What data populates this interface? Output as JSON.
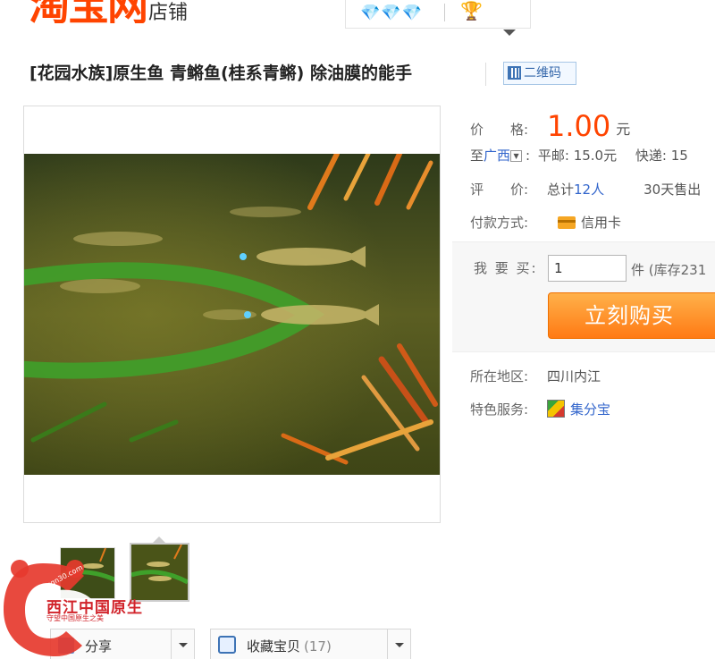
{
  "header": {
    "logo_main": "淘宝网",
    "logo_sub": "店铺",
    "credit_diamonds": "💎💎💎"
  },
  "title": "[花园水族]原生鱼 青鳉鱼(桂系青鳉) 除油膜的能手",
  "qr_label": "二维码",
  "price": {
    "label": "价　　格:",
    "value": "1.00",
    "unit": "元"
  },
  "shipping": {
    "label": "至",
    "region": "广西",
    "colon": ":",
    "post": "平邮: 15.0元",
    "express": "快递: 15"
  },
  "rating": {
    "label": "评　　价:",
    "total_prefix": "总计",
    "total_count": "12人",
    "sold": "30天售出"
  },
  "payment": {
    "label": "付款方式:",
    "method": "信用卡"
  },
  "purchase": {
    "qty_label": "我 要 买:",
    "qty_value": "1",
    "qty_unit": "件 (库存231",
    "buy_label": "立刻购买"
  },
  "location": {
    "label": "所在地区:",
    "value": "四川内江"
  },
  "service": {
    "label": "特色服务:",
    "value": "集分宝"
  },
  "share": {
    "label": "分享"
  },
  "favorite": {
    "label": "收藏宝贝",
    "count": "(17)"
  },
  "watermark": {
    "title": "西江中国原生",
    "subtitle": "守望中国原生之美",
    "url": "www.cqn30.com"
  },
  "colors": {
    "accent": "#ff4400",
    "buy_button": "#ff7a14",
    "link": "#3366cc"
  }
}
